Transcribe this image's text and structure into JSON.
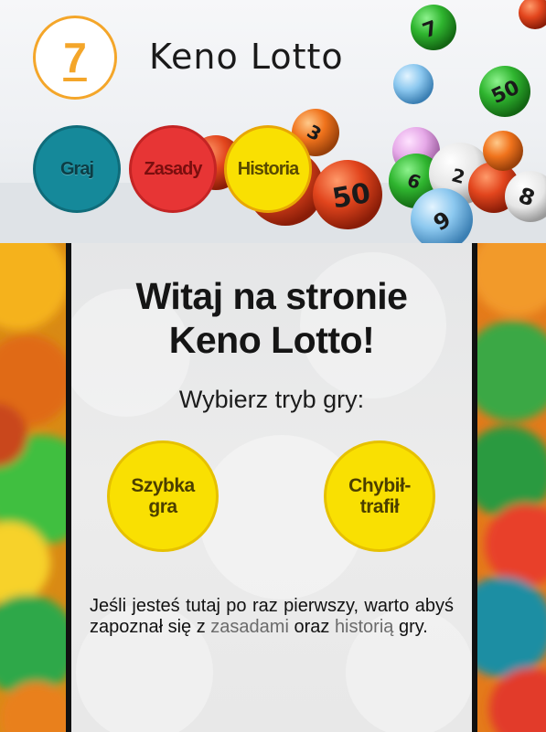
{
  "header": {
    "logo_digit": "7",
    "site_title": "Keno Lotto",
    "nav": [
      {
        "label": "Graj"
      },
      {
        "label": "Zasady"
      },
      {
        "label": "Historia"
      }
    ],
    "ball_numbers": [
      "7",
      "50",
      "3",
      "50",
      "6",
      "9",
      "8",
      "2"
    ]
  },
  "main": {
    "welcome_line1": "Witaj na stronie",
    "welcome_line2": "Keno Lotto!",
    "subtitle": "Wybierz tryb gry:",
    "mode_quick_line1": "Szybka",
    "mode_quick_line2": "gra",
    "mode_hit_line1": "Chybił-",
    "mode_hit_line2": "trafił",
    "intro_before": "Jeśli jesteś tutaj po raz pierwszy, warto abyś zapoznał się z ",
    "intro_link_rules": "zasadami",
    "intro_middle": " oraz ",
    "intro_link_history": "historią",
    "intro_after": " gry."
  },
  "colors": {
    "logo_accent": "#f4a62a",
    "graj": "#15899a",
    "zasady": "#e73535",
    "historia": "#f9e002",
    "mode_button": "#f9e002",
    "divider": "#111111"
  }
}
